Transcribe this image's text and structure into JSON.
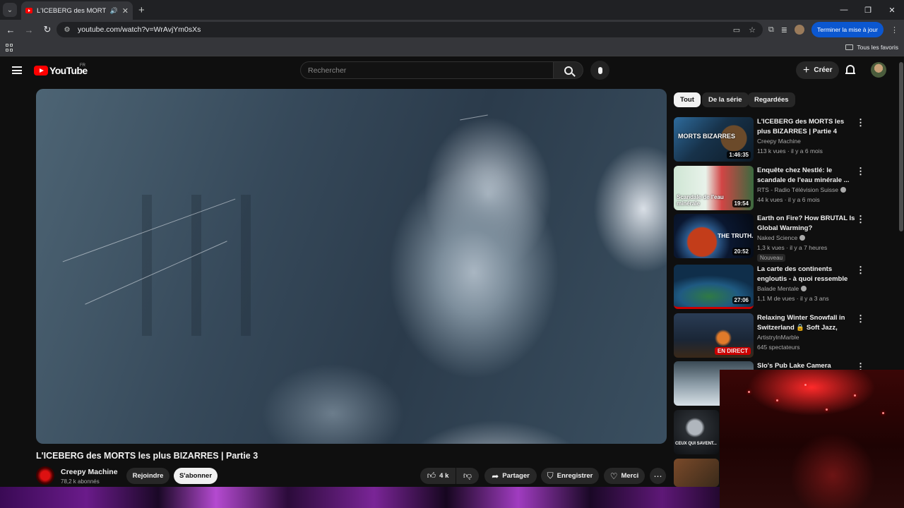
{
  "browser": {
    "tab": {
      "title": "L'ICEBERG des MORTS les p"
    },
    "url": "youtube.com/watch?v=WrAvjYm0sXs",
    "update_button": "Terminer la mise à jour",
    "bookmarks_all": "Tous les favoris"
  },
  "header": {
    "logo_text": "YouTube",
    "country": "FR",
    "search_placeholder": "Rechercher",
    "create_label": "Créer"
  },
  "video": {
    "title": "L'ICEBERG des MORTS les plus BIZARRES | Partie 3",
    "channel": "Creepy Machine",
    "subscribers": "78,2 k abonnés",
    "join_label": "Rejoindre",
    "subscribe_label": "S'abonner",
    "likes": "4 k",
    "share_label": "Partager",
    "save_label": "Enregistrer",
    "thanks_label": "Merci"
  },
  "filters": [
    "Tout",
    "De la série",
    "Regardées"
  ],
  "recommendations": [
    {
      "title": "L'ICEBERG des MORTS les plus BIZARRES | Partie 4",
      "channel": "Creepy Machine",
      "meta": "113 k vues · il y a 6 mois",
      "duration": "1:46:35",
      "verified": false
    },
    {
      "title": "Enquête chez Nestlé: le scandale de l'eau minérale ...",
      "channel": "RTS - Radio Télévision Suisse",
      "meta": "44 k vues · il y a 6 mois",
      "duration": "19:54",
      "verified": true
    },
    {
      "title": "Earth on Fire? How BRUTAL Is Global Warming?",
      "channel": "Naked Science",
      "meta": "1,3 k vues · il y a 7 heures",
      "duration": "20:52",
      "verified": true,
      "badge": "Nouveau"
    },
    {
      "title": "La carte des continents engloutis - à quoi ressemble la...",
      "channel": "Balade Mentale",
      "meta": "1,1 M de vues · il y a 3 ans",
      "duration": "27:06",
      "verified": true
    },
    {
      "title": "Relaxing Winter Snowfall in Switzerland 🔒 Soft Jazz, Coz...",
      "channel": "ArtistryInMarble",
      "meta": "645 spectateurs",
      "live": "EN DIRECT",
      "verified": false
    },
    {
      "title": "Slo's Pub Lake Camera",
      "channel": "",
      "meta": ""
    }
  ],
  "thumb_texts": {
    "t1": "MORTS BIZARRES",
    "t2": "Scandale de l'eau minérale",
    "t3": "THE TRUTH.",
    "t7": "CEUX QUI SAVENT..."
  }
}
